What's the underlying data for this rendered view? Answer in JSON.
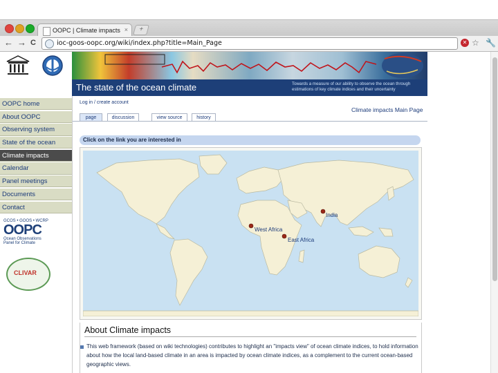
{
  "browser": {
    "tab_title": "OOPC | Climate impacts",
    "tab_close": "×",
    "new_tab": "+",
    "url": "ioc-goos-oopc.org/wiki/index.php?title=Main_Page",
    "back_glyph": "←",
    "forward_glyph": "→",
    "reload_glyph": "C",
    "stop_glyph": "✕",
    "star_glyph": "☆",
    "wrench_glyph": "🔧"
  },
  "header": {
    "title": "The state of the ocean climate",
    "subtitle": "Towards a measure of our ability to observe the ocean through estimations of key climate indices and their uncertainty",
    "logo_left_icon": "unesco-logo",
    "logo_right_icon": "ioc-logo"
  },
  "sidebar": {
    "items": [
      {
        "label": "OOPC home"
      },
      {
        "label": "About OOPC"
      },
      {
        "label": "Observing system"
      },
      {
        "label": "State of the ocean"
      },
      {
        "label": "Climate impacts",
        "active": true
      },
      {
        "label": "Calendar"
      },
      {
        "label": "Panel meetings"
      },
      {
        "label": "Documents"
      },
      {
        "label": "Contact"
      }
    ],
    "oopc_small": "GCOS • GOOS • WCRP",
    "oopc_big": "OOPC",
    "oopc_caption_1": "Ocean Observations",
    "oopc_caption_2": "Panel for Climate",
    "clivar": "CLIVAR"
  },
  "content": {
    "login": "Log in / create account",
    "page_title": "Climate impacts Main Page",
    "tabs": [
      {
        "label": "page",
        "active": true
      },
      {
        "label": "discussion"
      },
      {
        "label": "view source"
      },
      {
        "label": "history"
      }
    ],
    "click_bar": "Click on the link you are interested in",
    "map_markers": [
      {
        "label": "India"
      },
      {
        "label": "West Africa"
      },
      {
        "label": "East Africa"
      }
    ],
    "about_title": "About Climate impacts",
    "about_text": "This web framework (based on wiki technologies) contributes to highlight an \"impacts view\" of ocean climate indices, to hold information about how the local land-based climate in an area is impacted by ocean climate indices, as a complement to the current ocean-based geographic views."
  },
  "colors": {
    "nav_bg": "#d9dcc4",
    "nav_active": "#4b4b4b",
    "header_blue": "#1d3f78",
    "click_bar": "#c5d6ef",
    "ocean": "#c9e1f2",
    "land": "#f5f0d6",
    "marker": "#9a2818"
  }
}
